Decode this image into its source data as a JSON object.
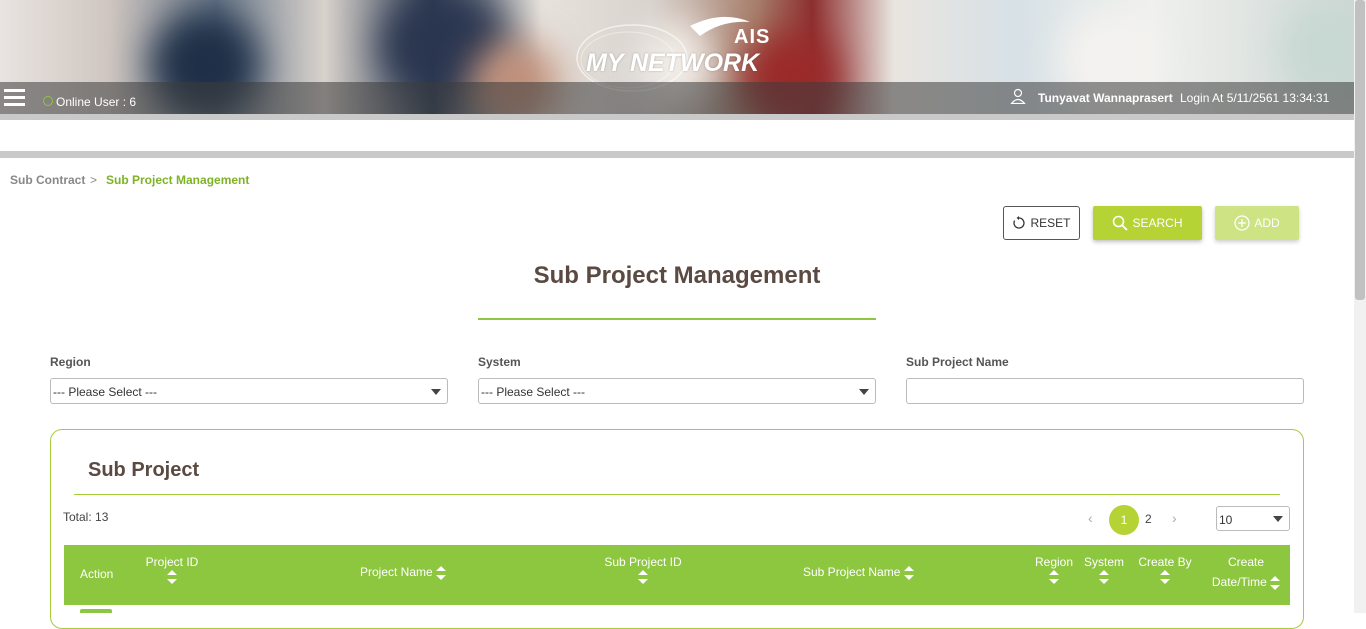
{
  "header": {
    "logo_top": "AIS",
    "logo_word": "MY NETWORK",
    "online_label": "Online User : 6",
    "user_name": "Tunyavat Wannaprasert",
    "login_at": "Login At 5/11/2561 13:34:31"
  },
  "breadcrumb": {
    "parent": "Sub Contract",
    "separator": ">",
    "current": "Sub Project Management"
  },
  "toolbar": {
    "reset_label": "RESET",
    "search_label": "SEARCH",
    "add_label": "ADD"
  },
  "page_title": "Sub Project Management",
  "filters": {
    "region_label": "Region",
    "region_value": "--- Please Select ---",
    "system_label": "System",
    "system_value": "--- Please Select ---",
    "sub_project_name_label": "Sub Project Name",
    "sub_project_name_value": ""
  },
  "panel": {
    "title": "Sub Project",
    "total": "Total: 13",
    "pagination": {
      "prev": "‹",
      "pages": [
        "1",
        "2"
      ],
      "current_page": "1",
      "next": "›",
      "page_size": "10"
    }
  },
  "table": {
    "columns": [
      "Action",
      "Project ID",
      "Project Name",
      "Sub Project ID",
      "Sub Project Name",
      "Region",
      "System",
      "Create By",
      "Create",
      "Date/Time"
    ]
  },
  "colors": {
    "accent": "#8dc63f",
    "button_green": "#b5d335",
    "title_brown": "#5a4a42"
  }
}
